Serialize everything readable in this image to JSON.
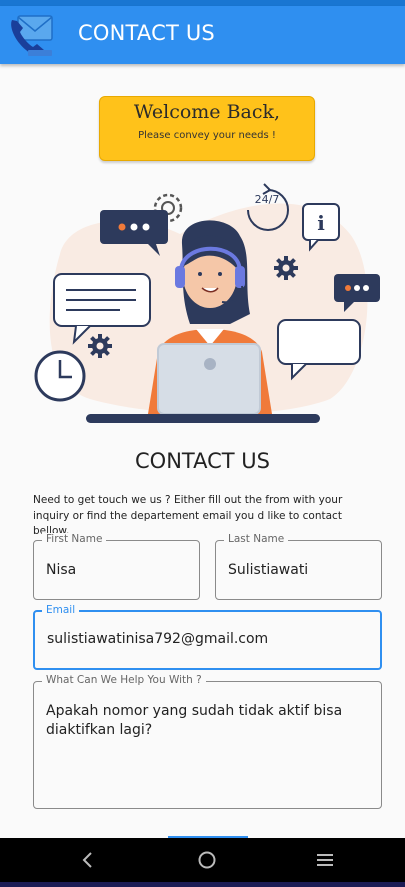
{
  "appbar": {
    "title": "CONTACT US",
    "logo_icon": "phone-envelope-icon"
  },
  "welcome": {
    "title": "Welcome Back,",
    "subtitle": "Please convey your needs !"
  },
  "illustration": {
    "badge_text": "24/7",
    "info_glyph": "i"
  },
  "form": {
    "heading": "CONTACT US",
    "intro": "Need to get touch we us ? Either fill out the from with your inquiry or find the departement email you d like to contact bellow.",
    "first_name": {
      "label": "First Name",
      "value": "Nisa"
    },
    "last_name": {
      "label": "Last Name",
      "value": "Sulistiawati"
    },
    "email": {
      "label": "Email",
      "value": "sulistiawatinisa792@gmail.com"
    },
    "message": {
      "label": "What Can We Help You With ?",
      "value": "Apakah nomor yang sudah tidak aktif bisa diaktifkan lagi?"
    }
  },
  "navbar": {
    "back_icon": "back-icon",
    "home_icon": "home-icon",
    "menu_icon": "menu-icon"
  },
  "colors": {
    "primary": "#2f8ff0",
    "accent": "#ffc21a",
    "illustration_navy": "#2d3a5c",
    "illustration_orange": "#f07a3a"
  }
}
